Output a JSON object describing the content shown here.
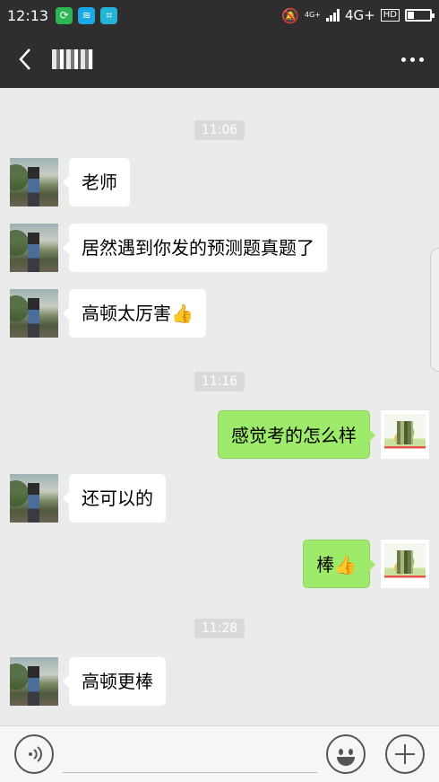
{
  "status_bar": {
    "time": "12:13",
    "network_small": "4G+",
    "network": "4G+",
    "hd": "HD"
  },
  "header": {
    "back_icon": "chevron-left-icon",
    "more_icon": "more-dots-icon"
  },
  "messages": [
    {
      "type": "time",
      "text": "11:06"
    },
    {
      "type": "msg",
      "side": "left",
      "text": "老师"
    },
    {
      "type": "msg",
      "side": "left",
      "text": "居然遇到你发的预测题真题了"
    },
    {
      "type": "msg",
      "side": "left",
      "text": "高顿太厉害",
      "emoji": "👍"
    },
    {
      "type": "time",
      "text": "11:16"
    },
    {
      "type": "msg",
      "side": "right",
      "text": "感觉考的怎么样"
    },
    {
      "type": "msg",
      "side": "left",
      "text": "还可以的"
    },
    {
      "type": "msg",
      "side": "right",
      "text": "棒",
      "emoji": "👍"
    },
    {
      "type": "time",
      "text": "11:28"
    },
    {
      "type": "msg",
      "side": "left",
      "text": "高顿更棒"
    }
  ],
  "input_bar": {
    "placeholder": "",
    "voice_icon": "voice-icon",
    "emoji_icon": "emoji-icon",
    "plus_icon": "plus-icon"
  },
  "colors": {
    "header_bg": "#2e2e2e",
    "chat_bg": "#ebebeb",
    "sent_bubble": "#9eea6a",
    "received_bubble": "#ffffff"
  }
}
